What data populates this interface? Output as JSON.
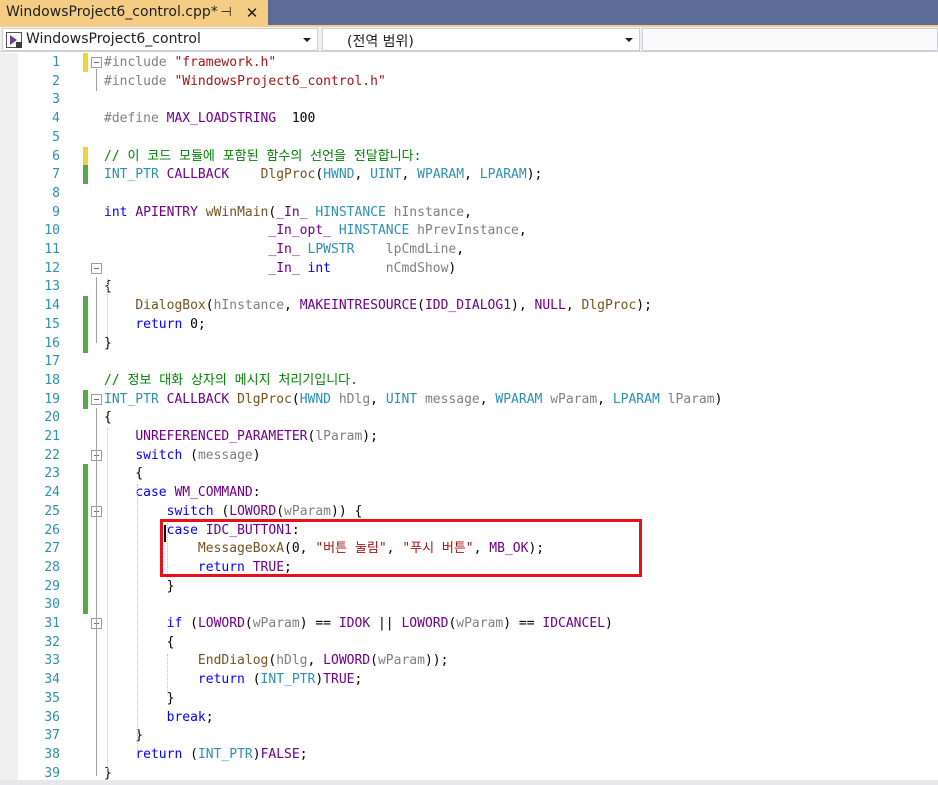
{
  "tab": {
    "title": "WindowsProject6_control.cpp*",
    "pin_glyph": "⊣",
    "close_glyph": "✕"
  },
  "navbar": {
    "project": "WindowsProject6_control",
    "scope": "(전역 범위)"
  },
  "icons": {
    "tab_pin": "pin-icon",
    "tab_close": "close-icon",
    "project": "cpp-project-icon",
    "dropdown": "chevron-down-icon",
    "fold": "collapse-icon"
  },
  "colors": {
    "tab_active": "#f5cc84",
    "tabbar_bg": "#5d6b99",
    "line_number": "#2b91af",
    "keyword": "#0000ff",
    "string": "#a31515",
    "comment": "#008000",
    "macro": "#6f008a",
    "type": "#2b91af",
    "change_saved": "#57a64a",
    "change_unsaved": "#efd440",
    "highlight_box": "#e8101a"
  },
  "code_lines": [
    {
      "n": "1",
      "change": "unsaved",
      "fold": true,
      "segs": [
        [
          "pp",
          "#include "
        ],
        [
          "s",
          "\"framework.h\""
        ]
      ]
    },
    {
      "n": "2",
      "change": "",
      "fold": false,
      "segs": [
        [
          "pp",
          "#include "
        ],
        [
          "s",
          "\"WindowsProject6_control.h\""
        ]
      ]
    },
    {
      "n": "3",
      "change": "",
      "fold": false,
      "segs": []
    },
    {
      "n": "4",
      "change": "",
      "fold": false,
      "segs": [
        [
          "pp",
          "#define "
        ],
        [
          "m",
          "MAX_LOADSTRING"
        ],
        [
          "",
          "  100"
        ]
      ]
    },
    {
      "n": "5",
      "change": "",
      "fold": false,
      "segs": []
    },
    {
      "n": "6",
      "change": "unsaved",
      "fold": false,
      "segs": [
        [
          "c",
          "// 이 코드 모듈에 포함된 함수의 선언을 전달합니다:"
        ]
      ]
    },
    {
      "n": "7",
      "change": "saved",
      "fold": false,
      "segs": [
        [
          "t",
          "INT_PTR"
        ],
        [
          "",
          " "
        ],
        [
          "m",
          "CALLBACK"
        ],
        [
          "",
          "    "
        ],
        [
          "f",
          "DlgProc"
        ],
        [
          "",
          "("
        ],
        [
          "t",
          "HWND"
        ],
        [
          "",
          ", "
        ],
        [
          "t",
          "UINT"
        ],
        [
          "",
          ", "
        ],
        [
          "t",
          "WPARAM"
        ],
        [
          "",
          ", "
        ],
        [
          "t",
          "LPARAM"
        ],
        [
          "",
          ");"
        ]
      ]
    },
    {
      "n": "8",
      "change": "",
      "fold": false,
      "segs": []
    },
    {
      "n": "9",
      "change": "",
      "fold": false,
      "segs": [
        [
          "k",
          "int"
        ],
        [
          "",
          " "
        ],
        [
          "m",
          "APIENTRY"
        ],
        [
          "",
          " "
        ],
        [
          "f",
          "wWinMain"
        ],
        [
          "",
          "("
        ],
        [
          "m",
          "_In_"
        ],
        [
          "",
          " "
        ],
        [
          "t",
          "HINSTANCE"
        ],
        [
          "",
          " "
        ],
        [
          "p",
          "hInstance"
        ],
        [
          "",
          ","
        ]
      ]
    },
    {
      "n": "10",
      "change": "",
      "fold": false,
      "segs": [
        [
          "",
          "                     "
        ],
        [
          "m",
          "_In_opt_"
        ],
        [
          "",
          " "
        ],
        [
          "t",
          "HINSTANCE"
        ],
        [
          "",
          " "
        ],
        [
          "p",
          "hPrevInstance"
        ],
        [
          "",
          ","
        ]
      ]
    },
    {
      "n": "11",
      "change": "",
      "fold": false,
      "segs": [
        [
          "",
          "                     "
        ],
        [
          "m",
          "_In_"
        ],
        [
          "",
          " "
        ],
        [
          "t",
          "LPWSTR"
        ],
        [
          "",
          "    "
        ],
        [
          "p",
          "lpCmdLine"
        ],
        [
          "",
          ","
        ]
      ]
    },
    {
      "n": "12",
      "change": "",
      "fold": true,
      "segs": [
        [
          "",
          "                     "
        ],
        [
          "m",
          "_In_"
        ],
        [
          "",
          " "
        ],
        [
          "k",
          "int"
        ],
        [
          "",
          "       "
        ],
        [
          "p",
          "nCmdShow"
        ],
        [
          "",
          ")"
        ]
      ]
    },
    {
      "n": "13",
      "change": "",
      "fold": false,
      "segs": [
        [
          "",
          "{"
        ]
      ]
    },
    {
      "n": "14",
      "change": "saved",
      "fold": false,
      "segs": [
        [
          "",
          "    "
        ],
        [
          "f",
          "DialogBox"
        ],
        [
          "",
          "("
        ],
        [
          "p",
          "hInstance"
        ],
        [
          "",
          ", "
        ],
        [
          "m",
          "MAKEINTRESOURCE"
        ],
        [
          "",
          "("
        ],
        [
          "m",
          "IDD_DIALOG1"
        ],
        [
          "",
          "), "
        ],
        [
          "m",
          "NULL"
        ],
        [
          "",
          ", "
        ],
        [
          "f",
          "DlgProc"
        ],
        [
          "",
          ");"
        ]
      ]
    },
    {
      "n": "15",
      "change": "saved",
      "fold": false,
      "segs": [
        [
          "",
          "    "
        ],
        [
          "k",
          "return"
        ],
        [
          "",
          " 0;"
        ]
      ]
    },
    {
      "n": "16",
      "change": "saved",
      "fold": false,
      "segs": [
        [
          "",
          "}"
        ]
      ]
    },
    {
      "n": "17",
      "change": "",
      "fold": false,
      "segs": []
    },
    {
      "n": "18",
      "change": "",
      "fold": false,
      "segs": [
        [
          "c",
          "// 정보 대화 상자의 메시지 처리기입니다."
        ]
      ]
    },
    {
      "n": "19",
      "change": "saved",
      "fold": true,
      "segs": [
        [
          "t",
          "INT_PTR"
        ],
        [
          "",
          " "
        ],
        [
          "m",
          "CALLBACK"
        ],
        [
          "",
          " "
        ],
        [
          "f",
          "DlgProc"
        ],
        [
          "",
          "("
        ],
        [
          "t",
          "HWND"
        ],
        [
          "",
          " "
        ],
        [
          "p",
          "hDlg"
        ],
        [
          "",
          ", "
        ],
        [
          "t",
          "UINT"
        ],
        [
          "",
          " "
        ],
        [
          "p",
          "message"
        ],
        [
          "",
          ", "
        ],
        [
          "t",
          "WPARAM"
        ],
        [
          "",
          " "
        ],
        [
          "p",
          "wParam"
        ],
        [
          "",
          ", "
        ],
        [
          "t",
          "LPARAM"
        ],
        [
          "",
          " "
        ],
        [
          "p",
          "lParam"
        ],
        [
          "",
          ")"
        ]
      ]
    },
    {
      "n": "20",
      "change": "",
      "fold": false,
      "segs": [
        [
          "",
          "{"
        ]
      ]
    },
    {
      "n": "21",
      "change": "",
      "fold": false,
      "segs": [
        [
          "",
          "    "
        ],
        [
          "m",
          "UNREFERENCED_PARAMETER"
        ],
        [
          "",
          "("
        ],
        [
          "p",
          "lParam"
        ],
        [
          "",
          ");"
        ]
      ]
    },
    {
      "n": "22",
      "change": "",
      "fold": true,
      "segs": [
        [
          "",
          "    "
        ],
        [
          "k",
          "switch"
        ],
        [
          "",
          " ("
        ],
        [
          "p",
          "message"
        ],
        [
          "",
          ")"
        ]
      ]
    },
    {
      "n": "23",
      "change": "saved",
      "fold": false,
      "segs": [
        [
          "",
          "    {"
        ]
      ]
    },
    {
      "n": "24",
      "change": "saved",
      "fold": false,
      "segs": [
        [
          "",
          "    "
        ],
        [
          "k",
          "case"
        ],
        [
          "",
          " "
        ],
        [
          "m",
          "WM_COMMAND"
        ],
        [
          "",
          ":"
        ]
      ]
    },
    {
      "n": "25",
      "change": "saved",
      "fold": true,
      "segs": [
        [
          "",
          "        "
        ],
        [
          "k",
          "switch"
        ],
        [
          "",
          " ("
        ],
        [
          "m",
          "LOWORD"
        ],
        [
          "",
          "("
        ],
        [
          "p",
          "wParam"
        ],
        [
          "",
          ")) {"
        ]
      ]
    },
    {
      "n": "26",
      "change": "saved",
      "fold": false,
      "segs": [
        [
          "",
          "        "
        ],
        [
          "k",
          "case"
        ],
        [
          "",
          " "
        ],
        [
          "m",
          "IDC_BUTTON1"
        ],
        [
          "",
          ":"
        ]
      ]
    },
    {
      "n": "27",
      "change": "saved",
      "fold": false,
      "segs": [
        [
          "",
          "            "
        ],
        [
          "f",
          "MessageBoxA"
        ],
        [
          "",
          "(0, "
        ],
        [
          "s",
          "\"버튼 눌림\""
        ],
        [
          "",
          ", "
        ],
        [
          "s",
          "\"푸시 버튼\""
        ],
        [
          "",
          ", "
        ],
        [
          "m",
          "MB_OK"
        ],
        [
          "",
          ");"
        ]
      ]
    },
    {
      "n": "28",
      "change": "saved",
      "fold": false,
      "segs": [
        [
          "",
          "            "
        ],
        [
          "k",
          "return"
        ],
        [
          "",
          " "
        ],
        [
          "m",
          "TRUE"
        ],
        [
          "",
          ";"
        ]
      ]
    },
    {
      "n": "29",
      "change": "saved",
      "fold": false,
      "segs": [
        [
          "",
          "        }"
        ]
      ]
    },
    {
      "n": "30",
      "change": "saved",
      "fold": false,
      "segs": []
    },
    {
      "n": "31",
      "change": "",
      "fold": true,
      "segs": [
        [
          "",
          "        "
        ],
        [
          "k",
          "if"
        ],
        [
          "",
          " ("
        ],
        [
          "m",
          "LOWORD"
        ],
        [
          "",
          "("
        ],
        [
          "p",
          "wParam"
        ],
        [
          "",
          ") == "
        ],
        [
          "m",
          "IDOK"
        ],
        [
          "",
          " || "
        ],
        [
          "m",
          "LOWORD"
        ],
        [
          "",
          "("
        ],
        [
          "p",
          "wParam"
        ],
        [
          "",
          ") == "
        ],
        [
          "m",
          "IDCANCEL"
        ],
        [
          "",
          ")"
        ]
      ]
    },
    {
      "n": "32",
      "change": "",
      "fold": false,
      "segs": [
        [
          "",
          "        {"
        ]
      ]
    },
    {
      "n": "33",
      "change": "",
      "fold": false,
      "segs": [
        [
          "",
          "            "
        ],
        [
          "f",
          "EndDialog"
        ],
        [
          "",
          "("
        ],
        [
          "p",
          "hDlg"
        ],
        [
          "",
          ", "
        ],
        [
          "m",
          "LOWORD"
        ],
        [
          "",
          "("
        ],
        [
          "p",
          "wParam"
        ],
        [
          "",
          "));"
        ]
      ]
    },
    {
      "n": "34",
      "change": "",
      "fold": false,
      "segs": [
        [
          "",
          "            "
        ],
        [
          "k",
          "return"
        ],
        [
          "",
          " ("
        ],
        [
          "t",
          "INT_PTR"
        ],
        [
          "",
          ")"
        ],
        [
          "m",
          "TRUE"
        ],
        [
          "",
          ";"
        ]
      ]
    },
    {
      "n": "35",
      "change": "",
      "fold": false,
      "segs": [
        [
          "",
          "        }"
        ]
      ]
    },
    {
      "n": "36",
      "change": "",
      "fold": false,
      "segs": [
        [
          "",
          "        "
        ],
        [
          "k",
          "break"
        ],
        [
          "",
          ";"
        ]
      ]
    },
    {
      "n": "37",
      "change": "",
      "fold": false,
      "segs": [
        [
          "",
          "    }"
        ]
      ]
    },
    {
      "n": "38",
      "change": "",
      "fold": false,
      "segs": [
        [
          "",
          "    "
        ],
        [
          "k",
          "return"
        ],
        [
          "",
          " ("
        ],
        [
          "t",
          "INT_PTR"
        ],
        [
          "",
          ")"
        ],
        [
          "m",
          "FALSE"
        ],
        [
          "",
          ";"
        ]
      ]
    },
    {
      "n": "39",
      "change": "",
      "fold": false,
      "segs": [
        [
          "",
          "}"
        ]
      ]
    }
  ]
}
